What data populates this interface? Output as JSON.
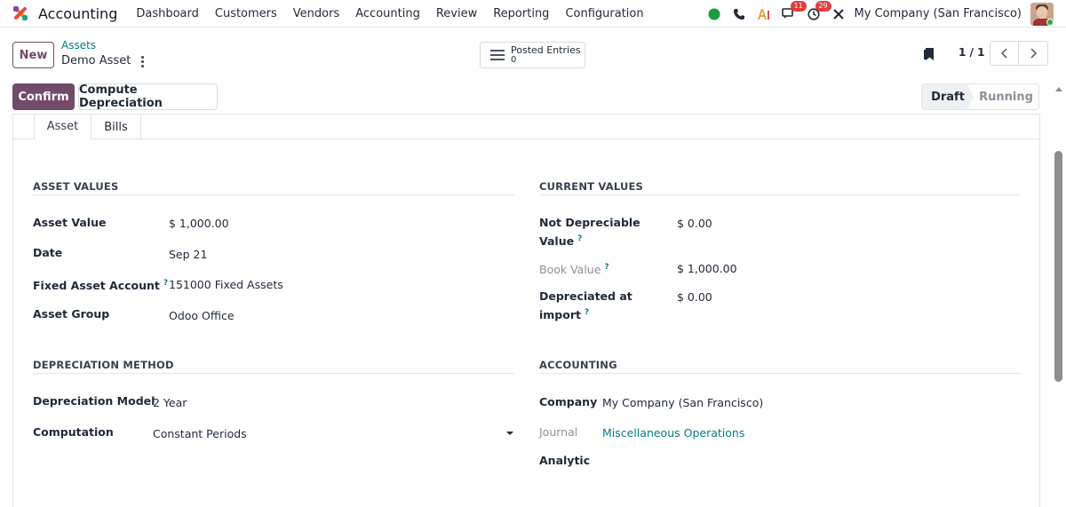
{
  "navbar": {
    "app_name": "Accounting",
    "menu": [
      "Dashboard",
      "Customers",
      "Vendors",
      "Accounting",
      "Review",
      "Reporting",
      "Configuration"
    ],
    "messages_badge": "11",
    "activities_badge": "29",
    "company": "My Company (San Francisco)"
  },
  "control": {
    "new_label": "New",
    "breadcrumb_parent": "Assets",
    "breadcrumb_current": "Demo Asset",
    "smart_button_label": "Posted Entries",
    "smart_button_value": "0",
    "pager": "1 / 1"
  },
  "statusbar": {
    "confirm_label": "Confirm",
    "compute_label": "Compute Depreciation",
    "stages": [
      "Draft",
      "Running"
    ],
    "active_stage": "Draft"
  },
  "tabs": [
    "Asset",
    "Bills"
  ],
  "asset_values": {
    "title": "ASSET VALUES",
    "asset_value_label": "Asset Value",
    "asset_value": "$ 1,000.00",
    "date_label": "Date",
    "date": "Sep 21",
    "fixed_account_label": "Fixed Asset Account",
    "fixed_account": "151000 Fixed Assets",
    "asset_group_label": "Asset Group",
    "asset_group": "Odoo Office"
  },
  "current_values": {
    "title": "CURRENT VALUES",
    "not_depreciable_label_1": "Not Depreciable",
    "not_depreciable_label_2": "Value",
    "not_depreciable": "$ 0.00",
    "book_value_label": "Book Value",
    "book_value": "$ 1,000.00",
    "depreciated_label_1": "Depreciated at",
    "depreciated_label_2": "import",
    "depreciated": "$ 0.00"
  },
  "depreciation": {
    "title": "DEPRECIATION METHOD",
    "model_label": "Depreciation Model",
    "model": "2 Year",
    "computation_label": "Computation",
    "computation": "Constant Periods"
  },
  "accounting": {
    "title": "ACCOUNTING",
    "company_label": "Company",
    "company": "My Company (San Francisco)",
    "journal_label": "Journal",
    "journal": "Miscellaneous Operations",
    "analytic_label": "Analytic"
  },
  "help_mark": "?",
  "colors": {
    "brand": "#714b67",
    "link": "#017e84",
    "badge": "#e23d3d",
    "online": "#28a745"
  }
}
